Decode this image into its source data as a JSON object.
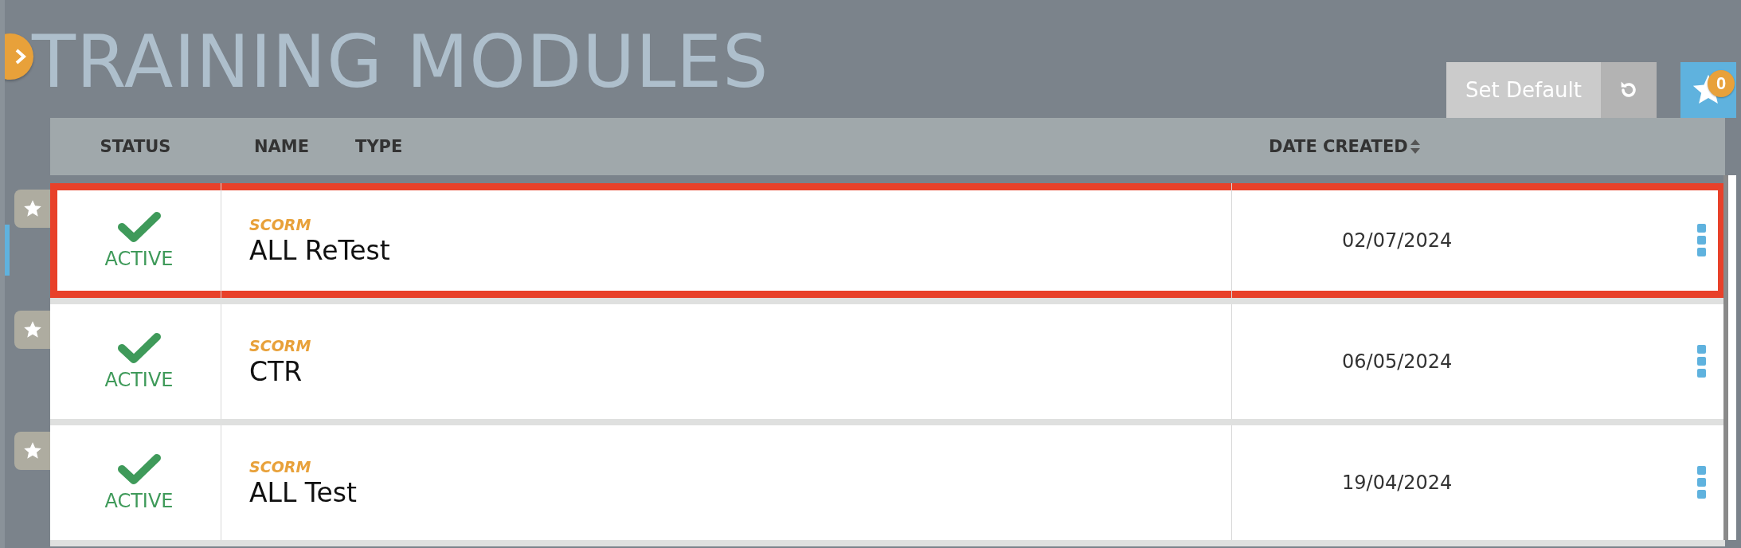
{
  "page": {
    "title": "TRAINING MODULES"
  },
  "toolbar": {
    "set_default": "Set Default",
    "favorites_count": "0"
  },
  "table": {
    "columns": [
      {
        "kind": "status",
        "label": "STATUS"
      },
      {
        "kind": "name",
        "label": "NAME"
      },
      {
        "kind": "type",
        "label": "TYPE"
      },
      {
        "kind": "date",
        "label": "DATE CREATED",
        "sortable": true
      }
    ],
    "rows": [
      {
        "status": "ACTIVE",
        "type": "SCORM",
        "name": "ALL ReTest",
        "date": "02/07/2024",
        "selected": true
      },
      {
        "status": "ACTIVE",
        "type": "SCORM",
        "name": "CTR",
        "date": "06/05/2024",
        "selected": false
      },
      {
        "status": "ACTIVE",
        "type": "SCORM",
        "name": "ALL Test",
        "date": "19/04/2024",
        "selected": false
      }
    ]
  }
}
